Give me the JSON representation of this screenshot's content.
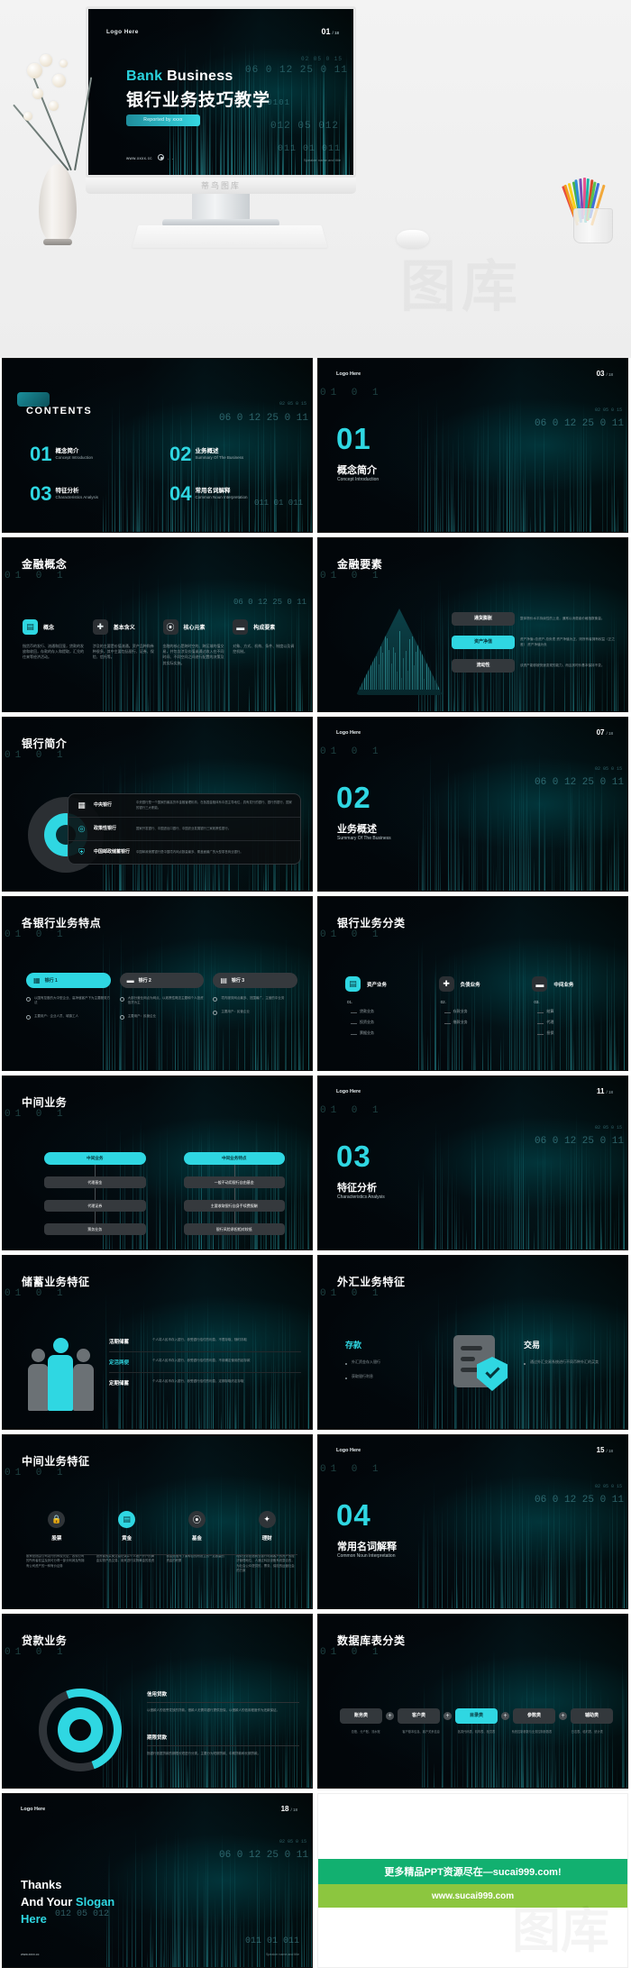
{
  "hero": {
    "logo": "Logo Here",
    "page": "01",
    "page_total": "/ 18",
    "title_en_accent": "Bank",
    "title_en_rest": " Business",
    "title_cn": "银行业务技巧教学",
    "button": "Reported by xxxx",
    "url": "www.xxxx.cc",
    "speaker": "Speaker name and title",
    "brand": "蒂鸟图库",
    "digits": [
      "02  05  0 15",
      "06  0 12      25  0 11",
      "0101",
      "012    05  012",
      "011        01  011"
    ]
  },
  "slides": {
    "contents": {
      "heading": "CONTENTS",
      "items": [
        {
          "num": "01",
          "cn": "概念简介",
          "en": "Concept\nIntroduction"
        },
        {
          "num": "02",
          "cn": "业务概述",
          "en": "Summary Of\nThe Business"
        },
        {
          "num": "03",
          "cn": "特征分析",
          "en": "Characteristics\nAnalysis"
        },
        {
          "num": "04",
          "cn": "常用名词解释",
          "en": "Common Noun\nInterpretation"
        }
      ]
    },
    "section01": {
      "logo": "Logo Here",
      "page": "03",
      "total": "/ 18",
      "num": "01",
      "cn": "概念简介",
      "en": "Concept Introduction"
    },
    "section02": {
      "logo": "Logo Here",
      "page": "07",
      "total": "/ 18",
      "num": "02",
      "cn": "业务概述",
      "en": "Summary Of The Business"
    },
    "section03": {
      "logo": "Logo Here",
      "page": "11",
      "total": "/ 18",
      "num": "03",
      "cn": "特征分析",
      "en": "Characteristics Analysis"
    },
    "section04": {
      "logo": "Logo Here",
      "page": "15",
      "total": "/ 18",
      "num": "04",
      "cn": "常用名词解释",
      "en": "Common Noun Interpretation"
    },
    "finance_concept": {
      "title": "金融概念",
      "code": "01 0 1",
      "tiles": [
        {
          "icon": "image-icon",
          "glyph": "▤",
          "label": "概念",
          "body": "指货币的发行、流通和回笼，贷款的发放和收回，存款的存入和提取，汇兑的往来等经济活动。",
          "active": true
        },
        {
          "icon": "plus-icon",
          "glyph": "✚",
          "label": "基本含义",
          "body": "涉及的主要是价值流通。资产品种和券种很多，其中主要包括银行、证券、保险、信托等。",
          "active": false
        },
        {
          "icon": "gear-icon",
          "glyph": "⦿",
          "label": "核心元素",
          "body": "金融的核心是跨时空的、跨区域的值交易，并包含涉及价值或通过收入在不同时间、不同空间之间进行配置的决策及其实际实施。",
          "active": false
        },
        {
          "icon": "briefcase-icon",
          "glyph": "▬",
          "label": "构成要素",
          "body": "对象、方式、机构、条件、制度以及调控机制。",
          "active": false
        }
      ]
    },
    "finance_elements": {
      "title": "金融要素",
      "code": "01 0 1",
      "rows": [
        {
          "label": "通货膨胀",
          "desc": "整体物价水平持续性的上涨，通常以消费者价格指数衡量。",
          "active": false
        },
        {
          "label": "资产净值",
          "desc": "资产净值=总资产-总负债\n资产净值为正，则所有者拥有权益（正之差）\n资产净值为负",
          "active": true
        },
        {
          "label": "流动性",
          "desc": "该资产能够被快速变现的能力，而且其时价基本保持不变。",
          "active": false
        }
      ]
    },
    "bank_intro": {
      "title": "银行简介",
      "code": "01 0 1",
      "items": [
        {
          "icon": "bank-icon",
          "glyph": "🏦",
          "name": "中央银行",
          "desc": "中央银行是一个国家的最高货币金融管理机构，在各国金融体系中居主导地位，具有发行的银行、银行的银行、国家的银行三大职能。",
          "active": false
        },
        {
          "icon": "circle-icon",
          "glyph": "◎",
          "name": "政策性银行",
          "desc": "国家开发银行、中国进出口银行、中国农业发展银行三家政策性银行。",
          "active": true
        },
        {
          "icon": "post-icon",
          "glyph": "⛨",
          "name": "中国邮政储蓄银行",
          "desc": "中国邮政储蓄银行是中国境内网点数量最多、覆盖面最广的大型零售商业银行。",
          "active": true
        }
      ]
    },
    "bank_features": {
      "title": "各银行业务特点",
      "code": "01 0 1",
      "cols": [
        {
          "icon": "bank-icon",
          "glyph": "🏦",
          "head": "银行 1",
          "active": true,
          "items": [
            "以国有控股的大中型企业、高净值客户下为主要服务方法",
            "主要用户：企业人员、城镇工人"
          ]
        },
        {
          "icon": "briefcase-icon",
          "glyph": "▬",
          "head": "银行 2",
          "active": false,
          "items": [
            "大部分营业网点为网点、以政策性概念主题和个人投资信贷为主",
            "主要用户：民营企业"
          ]
        },
        {
          "icon": "card-icon",
          "glyph": "▤",
          "head": "银行 3",
          "active": false,
          "items": [
            "境内服务网点最多、范围最广、主营的中业务",
            "主要用户：民营企业"
          ]
        }
      ]
    },
    "bank_category": {
      "title": "银行业务分类",
      "code": "01 0 1",
      "cols": [
        {
          "icon": "image-icon",
          "glyph": "▤",
          "head": "资产业务",
          "active": true,
          "no": "01.",
          "items": [
            "贷款业务",
            "投资业务",
            "票据业务"
          ]
        },
        {
          "icon": "plus-icon",
          "glyph": "✚",
          "head": "负债业务",
          "active": false,
          "no": "02.",
          "items": [
            "存款业务",
            "借款业务"
          ]
        },
        {
          "icon": "card-icon",
          "glyph": "▬",
          "head": "中间业务",
          "active": false,
          "no": "03.",
          "items": [
            "结算",
            "代理",
            "担保"
          ]
        }
      ]
    },
    "intermediate": {
      "title": "中间业务",
      "code": "01 0 1",
      "cols": [
        {
          "head": "中间业务",
          "nodes": [
            "代理基金",
            "代理证券",
            "票务业务"
          ]
        },
        {
          "head": "中间业务特点",
          "nodes": [
            "一般不动用银行自由基金",
            "主要收取银行自身手续费报酬",
            "银行风险承担相对较低"
          ]
        }
      ]
    },
    "savings": {
      "title": "储蓄业务特征",
      "code": "01 0 1",
      "rows": [
        {
          "k": "活期储蓄",
          "v": "个人将人民币存入银行，参受银行给付的利息，不限存取、随时存取",
          "active": false
        },
        {
          "k": "定活两便",
          "v": "个人将人民币存入银行，参受银行给付的利息，不用确定使用的起存款",
          "active": true
        },
        {
          "k": "定期储蓄",
          "v": "个人将人民币存入银行，参受银行给付的利息，定期存取约定存取",
          "active": false
        }
      ]
    },
    "forex": {
      "title": "外汇业务特征",
      "code": "01 0 1",
      "left": {
        "head": "存款",
        "items": [
          "外汇资金存入银行",
          "获取银行利息"
        ]
      },
      "right": {
        "head": "交易",
        "items": [
          "通过外汇交易系统进行不同币种外汇的买卖"
        ]
      }
    },
    "intermediate_feat": {
      "title": "中间业务特征",
      "code": "01 0 1",
      "cols": [
        {
          "icon": "lock-icon",
          "glyph": "🔒",
          "t": "股票",
          "active": false,
          "b": "股票是指由公司发行的有权凭证，表现公司的所有者权益及其可分得一部分利润及所拥有公司资产的一种有价证券"
        },
        {
          "icon": "image-icon",
          "glyph": "▤",
          "t": "黄金",
          "active": true,
          "b": "投资者的买卖交易记录并个人账户开户的黄金实物产品交易，用来进行实物黄金的投资"
        },
        {
          "icon": "gear-icon",
          "glyph": "⦿",
          "t": "基金",
          "active": false,
          "b": "基金是指为了某种目的而设立的一定数量的资金的积累"
        },
        {
          "icon": "plus-icon",
          "glyph": "✦",
          "t": "理财",
          "active": false,
          "b": "理财业务是指商业银行利用客户的资产的经济管理地位、人通过科技设备系统整合的，为社会公众提供的，票务、保险的运营社会的方案"
        }
      ]
    },
    "loan": {
      "title": "贷款业务",
      "code": "01 0 1",
      "a": {
        "k": "信用贷款",
        "v": "以借款人的信誉发放的贷款。借款人无需向银行提供担保，以借款人的信用程度作为还款保证。"
      },
      "b": {
        "k": "期限贷款",
        "v": "指银行依据贷款的期限长短进行分类。主要分为短期贷款、中期贷款和长期贷款。"
      }
    },
    "database": {
      "title": "数据库表分类",
      "code": "01 0 1",
      "pills": [
        {
          "label": "账务类",
          "active": false
        },
        {
          "label": "客户类",
          "active": false
        },
        {
          "label": "目录类",
          "active": true
        },
        {
          "label": "参数类",
          "active": false
        },
        {
          "label": "辅助类",
          "active": false
        }
      ],
      "subs": [
        "总账、分户账、流水账",
        "客户基本信息、客户关系信息",
        "各类代码表、机构表、柜员表",
        "系统控制参数与业务控制参数表",
        "日志表、临时表、统计表"
      ]
    },
    "thanks": {
      "logo": "Logo Here",
      "page": "18",
      "total": "/ 18",
      "l1": "Thanks",
      "l2a": "And Your ",
      "l2b": "Slogan",
      "l3": "Here",
      "url": "www.xxxx.cc",
      "speaker": "Speaker name and title"
    },
    "promo": {
      "line1": "更多精品PPT资源尽在—sucai999.com!",
      "line2": "www.sucai999.com",
      "watermark": "图库",
      "color1": "#12b070",
      "color2": "#8cc63f"
    }
  },
  "theme": {
    "accent": "#2fd7e2",
    "bg": "#03070a",
    "text": "#ffffff"
  }
}
